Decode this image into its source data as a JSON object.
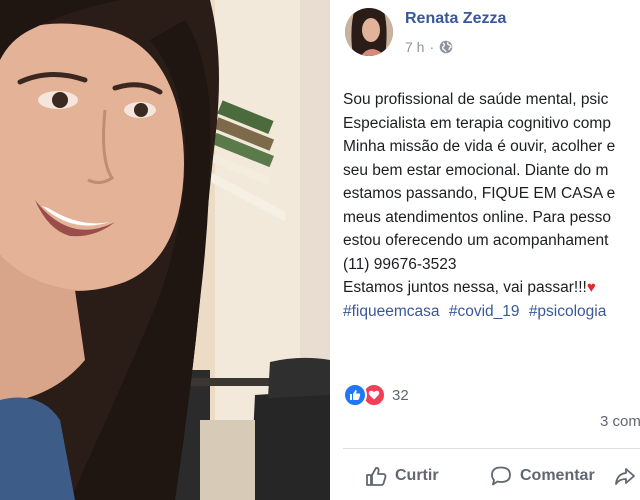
{
  "post": {
    "author": "Renata Zezza",
    "time": "7 h",
    "privacy_icon": "globe-icon",
    "text_lines": [
      "Sou profissional de saúde mental, psic",
      "Especialista em terapia cognitivo comp",
      "Minha missão de vida é ouvir, acolher e",
      "seu bem estar emocional. Diante do m",
      "estamos passando, FIQUE EM CASA e",
      "meus atendimentos online. Para pesso",
      "estou oferecendo um acompanhament",
      "(11) 99676-3523",
      "Estamos juntos nessa, vai passar!!!"
    ],
    "emoji": "♥",
    "hashtags": [
      "#fiqueemcasa",
      "#covid_19",
      "#psicologia"
    ],
    "reactions": {
      "icons": [
        "like-icon",
        "love-icon"
      ],
      "count": "32"
    },
    "comments_count": "3 com"
  },
  "actions": {
    "like_label": "Curtir",
    "comment_label": "Comentar"
  },
  "colors": {
    "name_link": "#385898",
    "meta_text": "#90949c",
    "like_blue": "#2078f4",
    "love_red": "#f33e58",
    "action_text": "#606770"
  }
}
